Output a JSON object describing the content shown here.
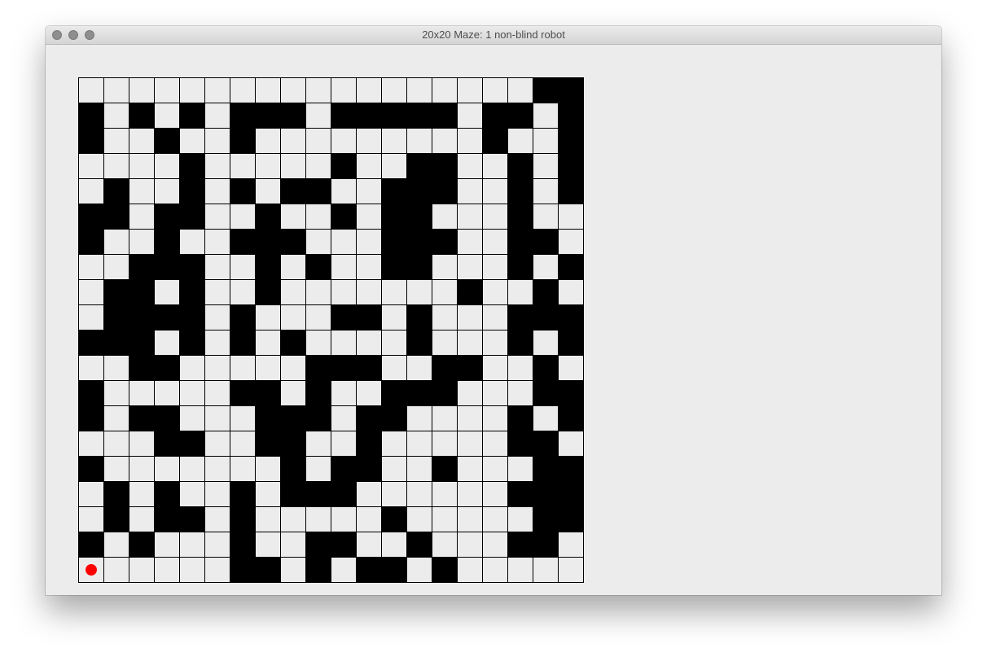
{
  "window": {
    "title": "20x20 Maze: 1 non-blind robot"
  },
  "maze": {
    "rows": 20,
    "cols": 20,
    "wall_color": "#000000",
    "open_color": "#ececec",
    "robot_color": "#ff0000",
    "grid": [
      "..................##.",
      "#.#.#.###.#####.##.#",
      "#..#..#.........#..#",
      "....#.....#..##..#.##",
      ".#..#.#.##..###..#.#",
      "##.##..#..#.##...#...",
      "#..#..###...###..##..",
      "..###..#.#..##...#.##",
      ".##.#..#.......#..#...",
      ".####.#...##.#...####",
      "###.#.#.#....#...#.#.",
      "..##.....###..##..#.##",
      "#.....##.#..###...##.",
      "#.##...###.##....#.#.",
      "...##..##..#.....##..",
      "#.......#.##..#...###",
      ".#.#..#.###......###.",
      ".#.##.#.....#.....###",
      "#.#...#..##..#...##.#",
      "......##.#.##.#......"
    ],
    "robot": {
      "row": 19,
      "col": 0
    }
  }
}
